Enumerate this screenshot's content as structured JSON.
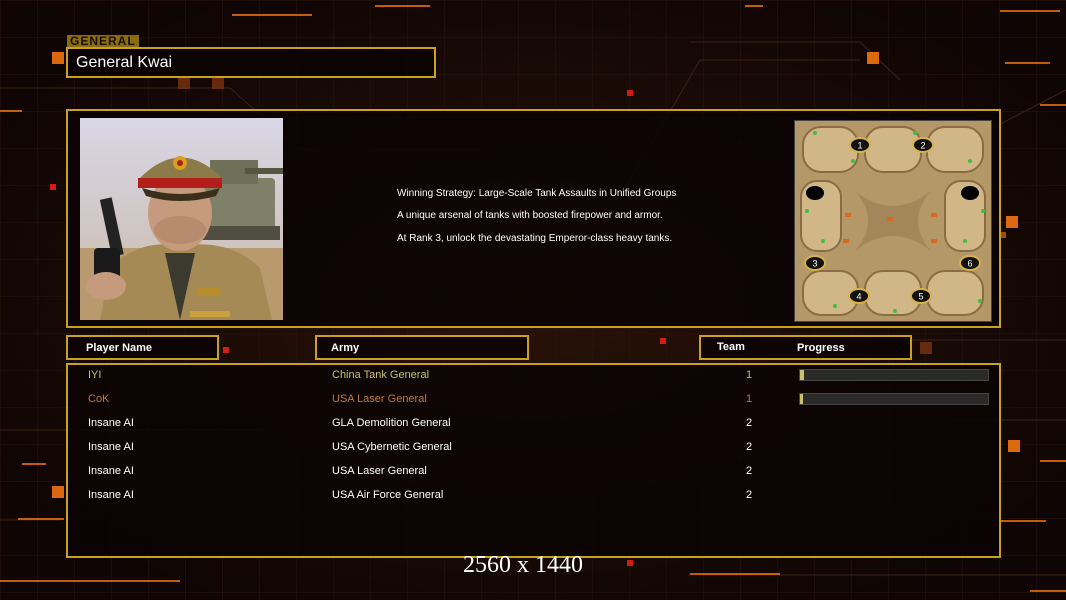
{
  "general": {
    "tag": "GENERAL",
    "name": "General Kwai"
  },
  "strategy": {
    "lines": [
      "Winning Strategy: Large-Scale Tank Assaults in Unified Groups",
      "A unique arsenal of tanks with boosted firepower and armor.",
      "At Rank 3, unlock the devastating Emperor-class heavy tanks."
    ]
  },
  "map": {
    "start_positions": [
      "1",
      "2",
      "3",
      "4",
      "5",
      "6"
    ]
  },
  "table": {
    "headers": {
      "player_name": "Player Name",
      "army": "Army",
      "team": "Team",
      "progress": "Progress"
    },
    "rows": [
      {
        "name": "IYI",
        "army": "China Tank General",
        "team": "1",
        "progress": 0.02,
        "color": "#c8c070"
      },
      {
        "name": "CoK",
        "army": "USA Laser General",
        "team": "1",
        "progress": 0.01,
        "color": "#c07a3a"
      },
      {
        "name": "Insane AI",
        "army": "GLA Demolition General",
        "team": "2",
        "color": "#ffffff"
      },
      {
        "name": "Insane AI",
        "army": "USA Cybernetic General",
        "team": "2",
        "color": "#ffffff"
      },
      {
        "name": "Insane AI",
        "army": "USA Laser General",
        "team": "2",
        "color": "#ffffff"
      },
      {
        "name": "Insane AI",
        "army": "USA Air Force General",
        "team": "2",
        "color": "#ffffff"
      }
    ]
  },
  "watermark": "2560 x 1440",
  "colors": {
    "frame": "#c8a21c",
    "accent": "#ff7a10",
    "background": "#120806"
  }
}
